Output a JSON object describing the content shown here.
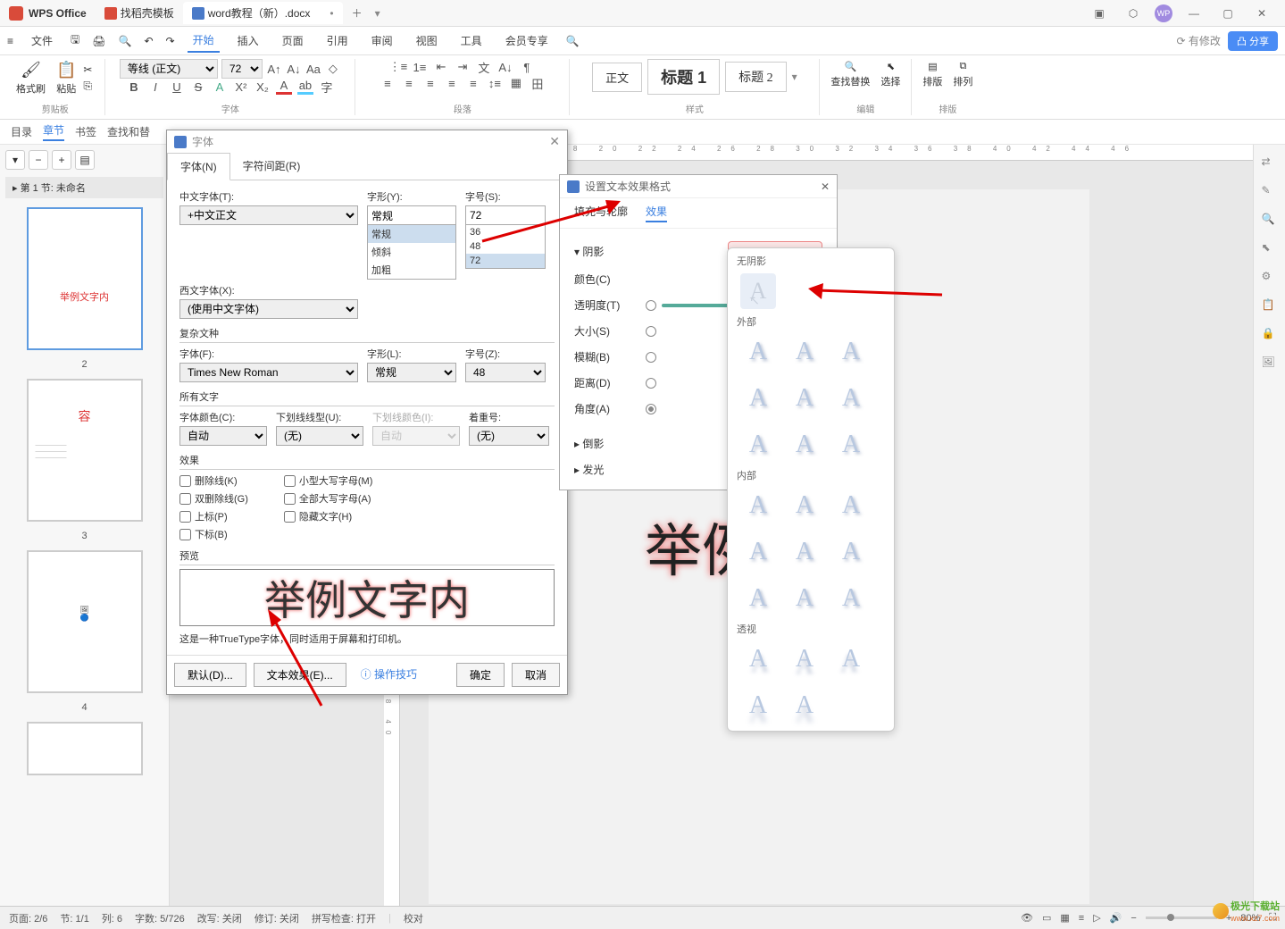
{
  "titlebar": {
    "app": "WPS Office",
    "tabs": [
      {
        "label": "找稻壳模板"
      },
      {
        "label": "word教程（新）.docx"
      }
    ]
  },
  "menubar": {
    "file": "文件",
    "items": [
      "开始",
      "插入",
      "页面",
      "引用",
      "审阅",
      "视图",
      "工具",
      "会员专享"
    ],
    "modify": "有修改",
    "share": "分享"
  },
  "ribbon": {
    "format_brush": "格式刷",
    "paste": "粘贴",
    "clipboard": "剪贴板",
    "font_name": "等线 (正文)",
    "font_size": "72",
    "font_group": "字体",
    "para_group": "段落",
    "style_normal": "正文",
    "style_h1": "标题 1",
    "style_h2": "标题 2",
    "style_group": "样式",
    "find_replace": "查找替换",
    "select": "选择",
    "edit_group": "编辑",
    "layout": "排版",
    "arrange": "排列",
    "layout_group": "排版"
  },
  "secbar": {
    "items": [
      "目录",
      "章节",
      "书签",
      "查找和替"
    ]
  },
  "ruler": {
    "h": "10 12 14 16 18 20 22 24 26 28 30 32 34 36 38 40 42 44 46",
    "v": "34 36 38 40"
  },
  "sidebar": {
    "section": "第 1 节: 未命名",
    "thumb1_text": "举例文字内",
    "thumb2_text": "容",
    "num2": "2",
    "num3": "3",
    "num4": "4"
  },
  "canvas": {
    "big_text": "举例文字"
  },
  "font_dialog": {
    "title": "字体",
    "tab_font": "字体(N)",
    "tab_spacing": "字符间距(R)",
    "cn_font_lbl": "中文字体(T):",
    "cn_font_val": "+中文正文",
    "style_lbl": "字形(Y):",
    "style_val": "常规",
    "style_opts": [
      "常规",
      "倾斜",
      "加粗"
    ],
    "size_lbl": "字号(S):",
    "size_val": "72",
    "size_opts": [
      "36",
      "48",
      "72"
    ],
    "en_font_lbl": "西文字体(X):",
    "en_font_val": "(使用中文字体)",
    "complex_hdr": "复杂文种",
    "c_font_lbl": "字体(F):",
    "c_font_val": "Times New Roman",
    "c_style_lbl": "字形(L):",
    "c_style_val": "常规",
    "c_size_lbl": "字号(Z):",
    "c_size_val": "48",
    "all_hdr": "所有文字",
    "color_lbl": "字体颜色(C):",
    "color_val": "自动",
    "underline_lbl": "下划线线型(U):",
    "underline_val": "(无)",
    "ul_color_lbl": "下划线颜色(I):",
    "ul_color_val": "自动",
    "emphasis_lbl": "着重号:",
    "emphasis_val": "(无)",
    "effects_hdr": "效果",
    "chk_strike": "删除线(K)",
    "chk_dstrike": "双删除线(G)",
    "chk_super": "上标(P)",
    "chk_sub": "下标(B)",
    "chk_smallcaps": "小型大写字母(M)",
    "chk_allcaps": "全部大写字母(A)",
    "chk_hidden": "隐藏文字(H)",
    "preview_hdr": "预览",
    "preview_text": "举例文字内",
    "preview_note": "这是一种TrueType字体，同时适用于屏幕和打印机。",
    "btn_default": "默认(D)...",
    "btn_text_effect": "文本效果(E)...",
    "btn_tips": "操作技巧",
    "btn_ok": "确定",
    "btn_cancel": "取消"
  },
  "effect_panel": {
    "title": "设置文本效果格式",
    "tab_fill": "填充与轮廓",
    "tab_effect": "效果",
    "shadow": "阴影",
    "color": "颜色(C)",
    "transparency": "透明度(T)",
    "size": "大小(S)",
    "blur": "模糊(B)",
    "distance": "距离(D)",
    "angle": "角度(A)",
    "reflection": "倒影",
    "glow": "发光"
  },
  "shadow_dd": {
    "none": "无阴影",
    "outer": "外部",
    "inner": "内部",
    "perspective": "透视"
  },
  "statusbar": {
    "page": "页面: 2/6",
    "section": "节: 1/1",
    "col": "列: 6",
    "chars": "字数: 5/726",
    "track": "改写: 关闭",
    "revision": "修订: 关闭",
    "spell": "拼写检查: 打开",
    "proof": "校对",
    "zoom": "80%"
  },
  "watermark": {
    "text1": "极光下载站",
    "text2": "www.xz7.com"
  }
}
